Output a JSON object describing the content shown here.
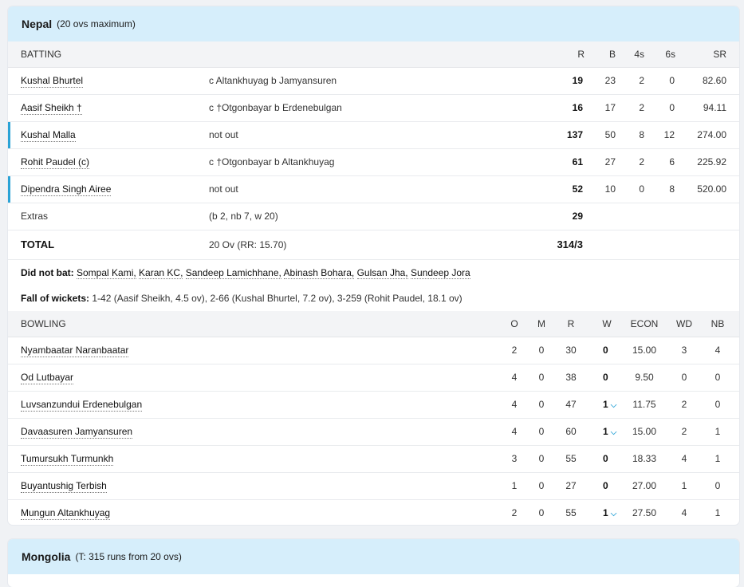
{
  "nepal": {
    "team": "Nepal",
    "subtitle": "(20 ovs maximum)",
    "batting_header": {
      "label": "BATTING",
      "r": "R",
      "b": "B",
      "fours": "4s",
      "sixes": "6s",
      "sr": "SR"
    },
    "batters": [
      {
        "name": "Kushal Bhurtel",
        "dismissal": "c Altankhuyag b Jamyansuren",
        "r": "19",
        "b": "23",
        "fours": "2",
        "sixes": "0",
        "sr": "82.60"
      },
      {
        "name": "Aasif Sheikh †",
        "dismissal": "c †Otgonbayar b Erdenebulgan",
        "r": "16",
        "b": "17",
        "fours": "2",
        "sixes": "0",
        "sr": "94.11"
      },
      {
        "name": "Kushal Malla",
        "dismissal": "not out",
        "r": "137",
        "b": "50",
        "fours": "8",
        "sixes": "12",
        "sr": "274.00"
      },
      {
        "name": "Rohit Paudel (c)",
        "dismissal": "c †Otgonbayar b Altankhuyag",
        "r": "61",
        "b": "27",
        "fours": "2",
        "sixes": "6",
        "sr": "225.92"
      },
      {
        "name": "Dipendra Singh Airee",
        "dismissal": "not out",
        "r": "52",
        "b": "10",
        "fours": "0",
        "sixes": "8",
        "sr": "520.00"
      }
    ],
    "extras": {
      "label": "Extras",
      "detail": "(b 2, nb 7, w 20)",
      "value": "29"
    },
    "total": {
      "label": "TOTAL",
      "overs": "20 Ov (RR: 15.70)",
      "score": "314/3"
    },
    "did_not_bat": {
      "label": "Did not bat:",
      "players": [
        "Sompal Kami,",
        "Karan KC,",
        "Sandeep Lamichhane,",
        "Abinash Bohara,",
        "Gulsan Jha,",
        "Sundeep Jora"
      ]
    },
    "fall_of_wickets": {
      "label": "Fall of wickets:",
      "text": "1-42 (Aasif Sheikh, 4.5 ov), 2-66 (Kushal Bhurtel, 7.2 ov), 3-259 (Rohit Paudel, 18.1 ov)"
    },
    "bowling_header": {
      "label": "BOWLING",
      "o": "O",
      "m": "M",
      "r": "R",
      "w": "W",
      "econ": "ECON",
      "wd": "WD",
      "nb": "NB"
    },
    "bowlers": [
      {
        "name": "Nyambaatar Naranbaatar",
        "o": "2",
        "m": "0",
        "r": "30",
        "w": "0",
        "econ": "15.00",
        "wd": "3",
        "nb": "4",
        "expand": ""
      },
      {
        "name": "Od Lutbayar",
        "o": "4",
        "m": "0",
        "r": "38",
        "w": "0",
        "econ": "9.50",
        "wd": "0",
        "nb": "0",
        "expand": ""
      },
      {
        "name": "Luvsanzundui Erdenebulgan",
        "o": "4",
        "m": "0",
        "r": "47",
        "w": "1",
        "econ": "11.75",
        "wd": "2",
        "nb": "0",
        "expand": "⌵"
      },
      {
        "name": "Davaasuren Jamyansuren",
        "o": "4",
        "m": "0",
        "r": "60",
        "w": "1",
        "econ": "15.00",
        "wd": "2",
        "nb": "1",
        "expand": "⌵"
      },
      {
        "name": "Tumursukh Turmunkh",
        "o": "3",
        "m": "0",
        "r": "55",
        "w": "0",
        "econ": "18.33",
        "wd": "4",
        "nb": "1",
        "expand": ""
      },
      {
        "name": "Buyantushig Terbish",
        "o": "1",
        "m": "0",
        "r": "27",
        "w": "0",
        "econ": "27.00",
        "wd": "1",
        "nb": "0",
        "expand": ""
      },
      {
        "name": "Mungun Altankhuyag",
        "o": "2",
        "m": "0",
        "r": "55",
        "w": "1",
        "econ": "27.50",
        "wd": "4",
        "nb": "1",
        "expand": "⌵"
      }
    ]
  },
  "mongolia": {
    "team": "Mongolia",
    "subtitle": "(T: 315 runs from 20 ovs)"
  },
  "colors": {
    "header_bg": "#d6eefb",
    "accent": "#2aa3d6"
  }
}
